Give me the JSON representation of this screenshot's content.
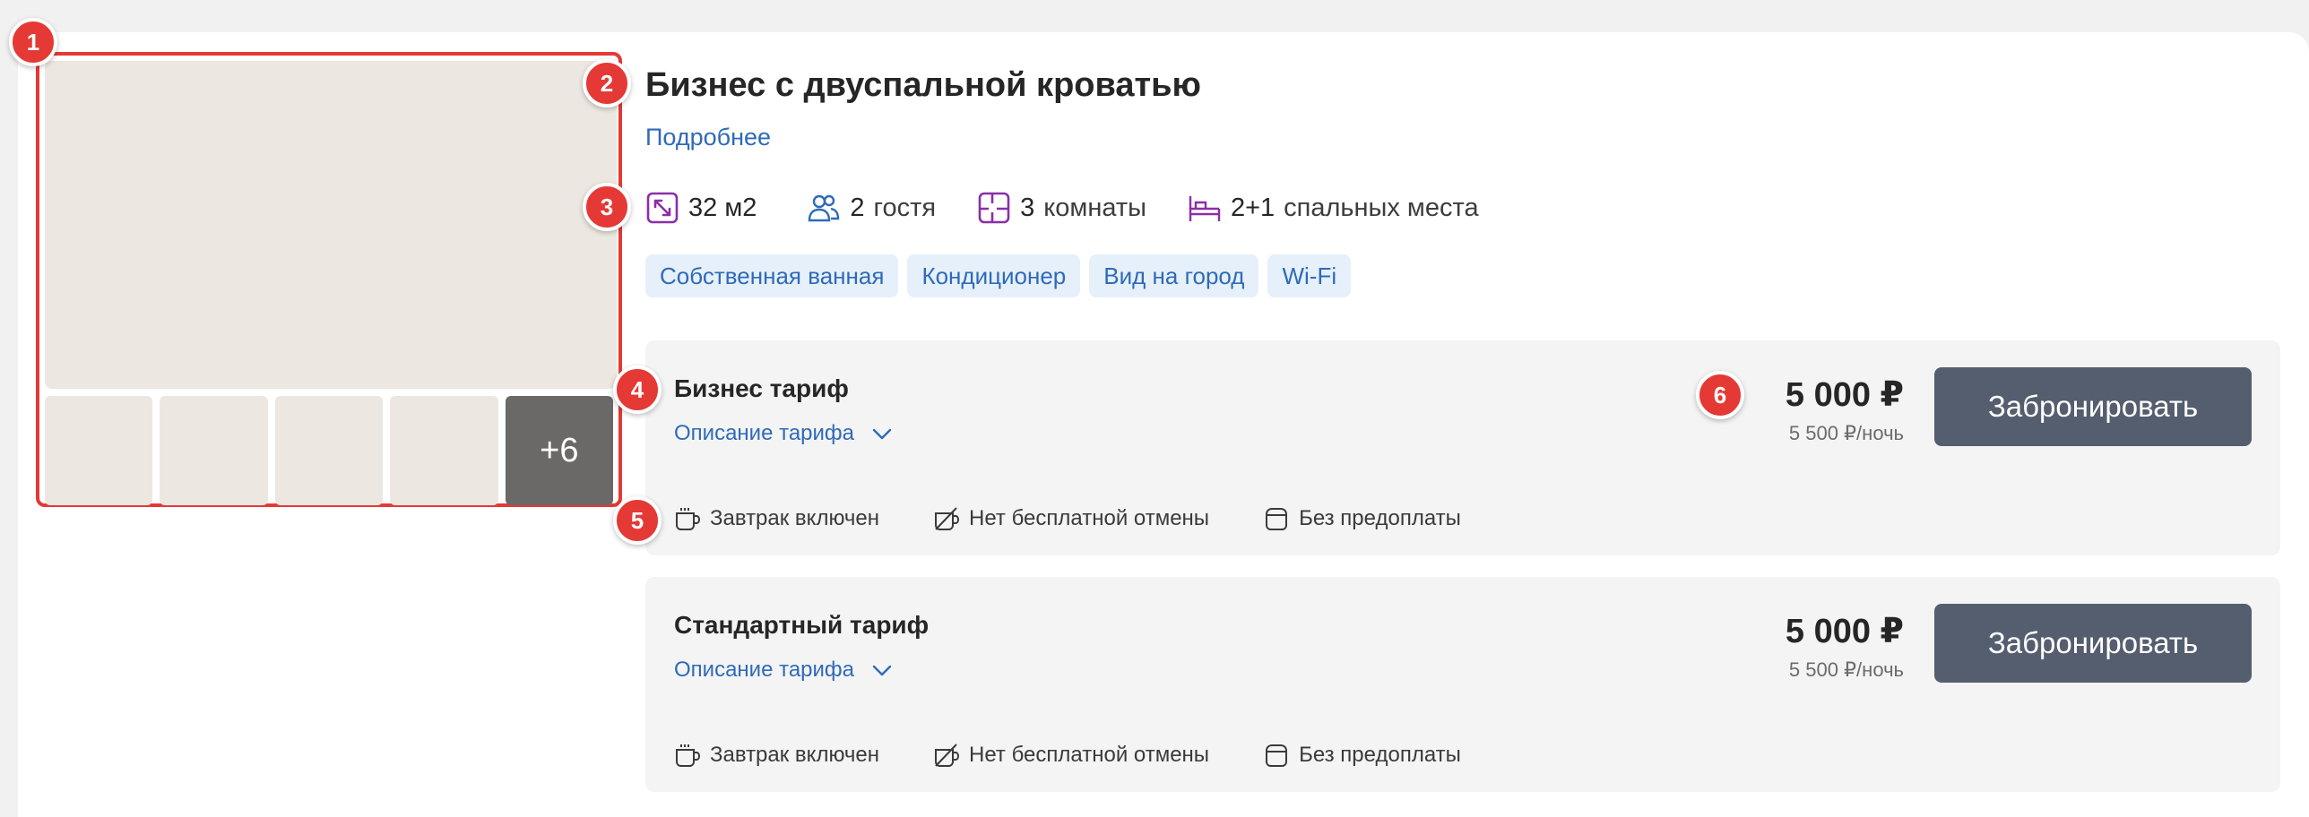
{
  "room": {
    "title": "Бизнес с двуспальной кроватью",
    "more_link": "Подробнее",
    "gallery": {
      "more_count": "+6"
    },
    "features": [
      {
        "icon": "area-icon",
        "num": "32 м2",
        "unit": ""
      },
      {
        "icon": "guests-icon",
        "num": "2",
        "unit": "гостя"
      },
      {
        "icon": "rooms-icon",
        "num": "3",
        "unit": "комнаты"
      },
      {
        "icon": "bed-icon",
        "num": "2+1",
        "unit": "спальных места"
      }
    ],
    "amenities": [
      "Собственная ванная",
      "Кондиционер",
      "Вид на город",
      "Wi-Fi"
    ]
  },
  "markers": [
    "1",
    "2",
    "3",
    "4",
    "5",
    "6"
  ],
  "tariffs": [
    {
      "name": "Бизнес тариф",
      "description_link": "Описание тарифа",
      "price": "5 000 ₽",
      "price_per_night": "5 500 ₽/ночь",
      "book_label": "Забронировать",
      "conditions": [
        {
          "icon": "cup-icon",
          "label": "Завтрак включен"
        },
        {
          "icon": "no-cancel-icon",
          "label": "Нет бесплатной отмены"
        },
        {
          "icon": "wallet-icon",
          "label": "Без предоплаты"
        }
      ]
    },
    {
      "name": "Стандартный тариф",
      "description_link": "Описание тарифа",
      "price": "5 000 ₽",
      "price_per_night": "5 500 ₽/ночь",
      "book_label": "Забронировать",
      "conditions": [
        {
          "icon": "cup-icon",
          "label": "Завтрак включен"
        },
        {
          "icon": "no-cancel-icon",
          "label": "Нет бесплатной отмены"
        },
        {
          "icon": "wallet-icon",
          "label": "Без предоплаты"
        }
      ]
    }
  ],
  "colors": {
    "marker": "#e53935",
    "link": "#2f6ab8",
    "icon_purple": "#8a2fa8",
    "icon_blue": "#2f6ab8",
    "button": "#545e6f"
  }
}
